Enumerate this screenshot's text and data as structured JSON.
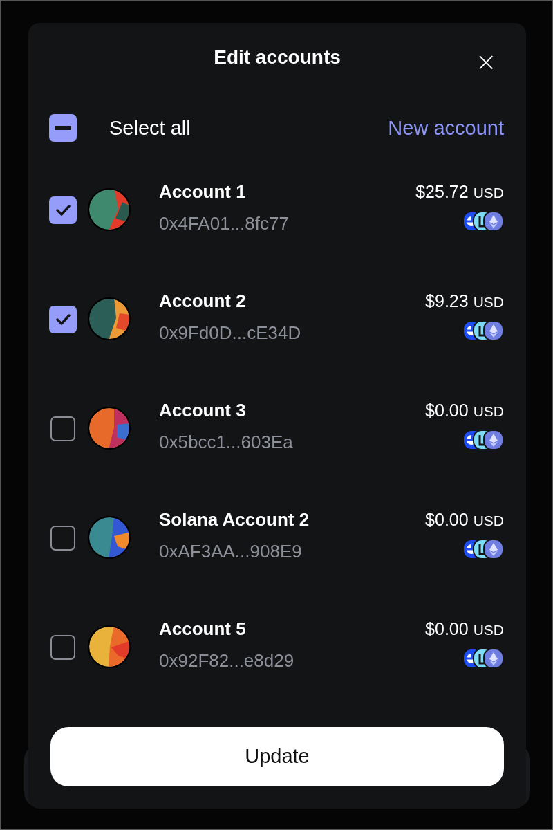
{
  "dialog": {
    "title": "Edit accounts",
    "close": "×"
  },
  "select_all": {
    "label": "Select all",
    "indeterminate": true
  },
  "new_account": "New account",
  "accounts": [
    {
      "name": "Account 1",
      "address": "0x4FA01...8fc77",
      "amount": "$25.72",
      "currency": "USD",
      "checked": true
    },
    {
      "name": "Account 2",
      "address": "0x9Fd0D...cE34D",
      "amount": "$9.23",
      "currency": "USD",
      "checked": true
    },
    {
      "name": "Account 3",
      "address": "0x5bcc1...603Ea",
      "amount": "$0.00",
      "currency": "USD",
      "checked": false
    },
    {
      "name": "Solana Account 2",
      "address": "0xAF3AA...908E9",
      "amount": "$0.00",
      "currency": "USD",
      "checked": false
    },
    {
      "name": "Account 5",
      "address": "0x92F82...e8d29",
      "amount": "$0.00",
      "currency": "USD",
      "checked": false
    }
  ],
  "update_button": "Update"
}
